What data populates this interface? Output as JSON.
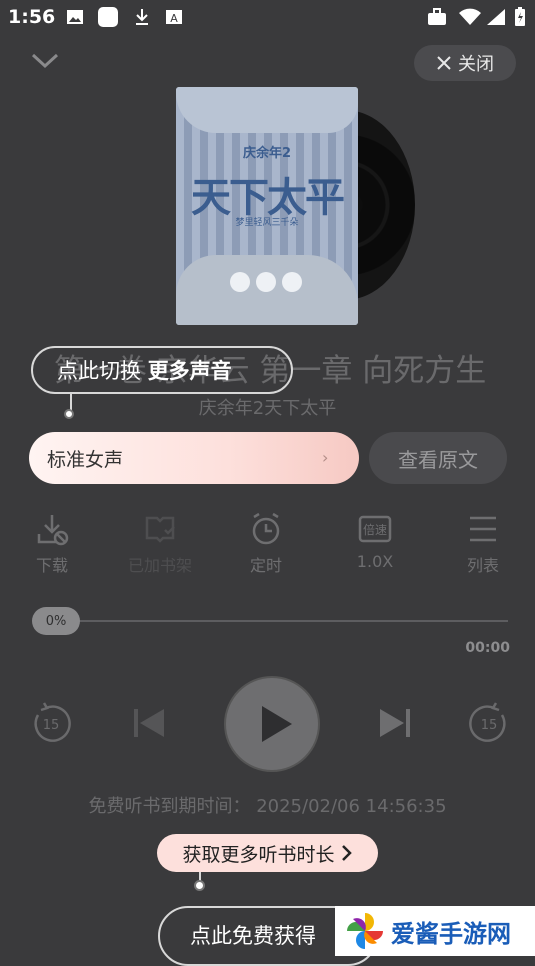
{
  "status_bar": {
    "time": "1:56"
  },
  "header": {
    "close_label": "关闭"
  },
  "cover": {
    "series": "庆余年2",
    "title": "天下太平",
    "author": "梦里轻风三千朵"
  },
  "chapter_title": "第一卷 京华云 第一章 向死方生",
  "book_title": "庆余年2天下太平",
  "tips": {
    "voice_tip_prefix": "点此切换 ",
    "voice_tip_bold": "更多声音",
    "free_tip": "点此免费获得"
  },
  "voice": {
    "current": "标准女声",
    "arrow": "›"
  },
  "view_original": "查看原文",
  "toolbar": [
    {
      "label": "下载",
      "icon": "download-icon"
    },
    {
      "label": "已加书架",
      "icon": "bookshelf-icon"
    },
    {
      "label": "定时",
      "icon": "timer-icon"
    },
    {
      "label": "1.0X",
      "icon": "speed-icon",
      "icon_text": "倍速"
    },
    {
      "label": "列表",
      "icon": "list-icon"
    }
  ],
  "progress": {
    "percent_label": "0%",
    "percent": 0,
    "duration": "00:00"
  },
  "controls": {
    "rewind_seconds": "15",
    "forward_seconds": "15"
  },
  "expire_text": "免费听书到期时间：  2025/02/06 14:56:35",
  "more_time_label": "获取更多听书时长",
  "watermark": "爱酱手游网",
  "colors": {
    "accent_pink": "#fde0dc",
    "background": "#3a3a3c"
  }
}
